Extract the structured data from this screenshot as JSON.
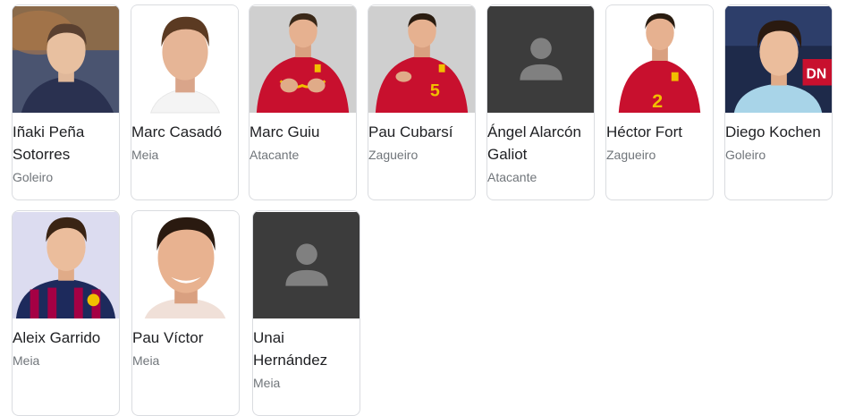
{
  "players": [
    {
      "name": "Iñaki Peña Sotorres",
      "role": "Goleiro",
      "photo": "goalkeeper-dark-kit-photo"
    },
    {
      "name": "Marc Casadó",
      "role": "Meia",
      "photo": "portrait-white-bg-photo"
    },
    {
      "name": "Marc Guiu",
      "role": "Atacante",
      "photo": "spain-red-kit-heart-hands-photo"
    },
    {
      "name": "Pau Cubarsí",
      "role": "Zagueiro",
      "photo": "spain-red-kit-number-5-photo"
    },
    {
      "name": "Ángel Alarcón Galiot",
      "role": "Atacante",
      "photo": "placeholder-avatar"
    },
    {
      "name": "Héctor Fort",
      "role": "Zagueiro",
      "photo": "spain-red-kit-number-2-photo"
    },
    {
      "name": "Diego Kochen",
      "role": "Goleiro",
      "photo": "stadium-blue-jacket-photo"
    },
    {
      "name": "Aleix Garrido",
      "role": "Meia",
      "photo": "barcelona-kit-photo"
    },
    {
      "name": "Pau Víctor",
      "role": "Meia",
      "photo": "portrait-smiling-photo"
    },
    {
      "name": "Unai Hernández",
      "role": "Meia",
      "photo": "placeholder-avatar"
    }
  ],
  "colors": {
    "spain_red": "#c8102e",
    "spain_yellow": "#f1bf00",
    "barca_blue": "#1d2a5c",
    "barca_garnet": "#a50044",
    "placeholder_bg": "#3c3c3c",
    "placeholder_icon": "#808080"
  }
}
